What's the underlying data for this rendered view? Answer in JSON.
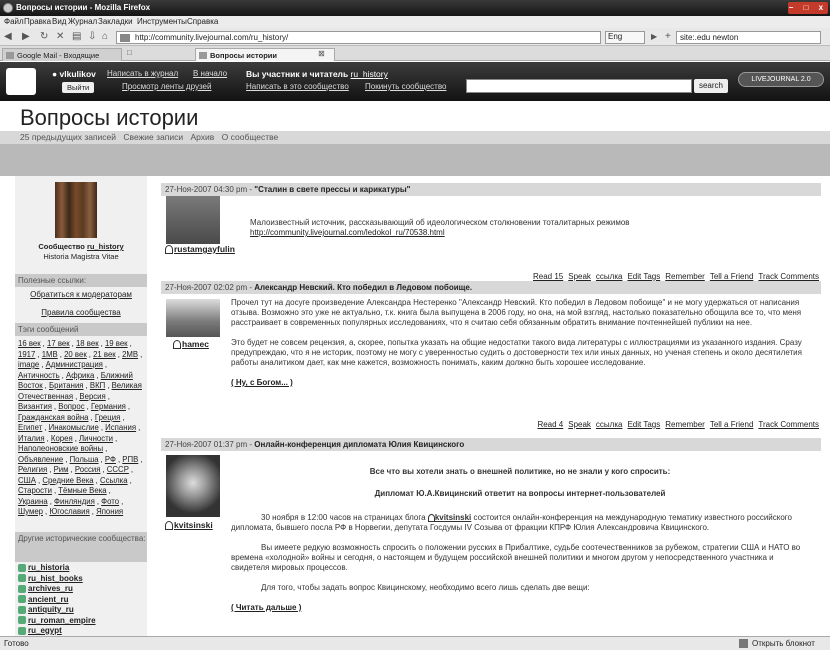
{
  "window": {
    "title": "Вопросы истории - Mozilla Firefox",
    "controls": "– □ x"
  },
  "menu": [
    "Файл",
    "Правка",
    "Вид",
    "Журнал",
    "Закладки",
    "Инструменты",
    "Справка"
  ],
  "nav": {
    "url": "http://community.livejournal.com/ru_history/",
    "search_engine": "Eng",
    "search_value": "site:.edu newton"
  },
  "tabs": [
    "Google Mail - Входящие",
    "Вопросы истории"
  ],
  "lj": {
    "username": "vlkulikov",
    "logout": "Выйти",
    "post_to_journal": "Написать в журнал",
    "to_start": "В начало",
    "friends_page": "Просмотр ленты друзей",
    "member_text": "Вы участник и читатель",
    "community": "ru_history",
    "post_to_community": "Написать в это сообщество",
    "leave_community": "Покинуть сообщество",
    "search_button": "search",
    "logo_text": "LIVEJOURNAL 2.0"
  },
  "community": {
    "title": "Вопросы истории",
    "nav": [
      "25 предыдущих записей",
      "Свежие записи",
      "Архив",
      "О сообществе"
    ]
  },
  "sidebar": {
    "community_prefix": "Сообщество",
    "community_name": "ru_history",
    "subtitle": "Historia Magistra Vitae",
    "useful_links_header": "Полезные ссылки:",
    "link_moderators": "Обратиться к модераторам",
    "link_rules": "Правила сообщества",
    "tags_header": "Тэги сообщений",
    "tags": [
      "16 век",
      "17 век",
      "18 век",
      "19 век",
      "1917",
      "1МВ",
      "20 век",
      "21 век",
      "2МВ",
      "image",
      "Администрация",
      "Античность",
      "Африка",
      "Ближний Восток",
      "Британия",
      "ВКП",
      "Великая Отечественная",
      "Версия",
      "Византия",
      "Вопрос",
      "Германия",
      "Гражданская война",
      "Греция",
      "Египет",
      "Инакомыслие",
      "Испания",
      "Италия",
      "Корея",
      "Личности",
      "Наполеоновские войны",
      "Объявление",
      "Польша",
      "РФ",
      "РПВ",
      "Религия",
      "Рим",
      "Россия",
      "СССР",
      "США",
      "Средние Века",
      "Ссылка",
      "Старости",
      "Тёмные Века",
      "Украина",
      "Финляндия",
      "Фото",
      "Шумер",
      "Югославия",
      "Япония"
    ],
    "other_header": "Другие исторические сообщества:",
    "communities": [
      "ru_historia",
      "ru_hist_books",
      "archives_ru",
      "ancient_ru",
      "antiquity_ru",
      "ru_roman_empire",
      "ru_egypt"
    ]
  },
  "posts": [
    {
      "date": "27-Ноя-2007 04:30 pm",
      "title": "\"Сталин в свете прессы и карикатуры\"",
      "user": "rustamgayfulin",
      "body": [
        "Малоизвестный источник, рассказывающий об идеологическом столкновении тоталитарных режимов"
      ],
      "link": "http://community.livejournal.com/ledokol_ru/70538.html",
      "actions": [
        "Read 15",
        "Speak",
        "ссылка",
        "Edit Tags",
        "Remember",
        "Tell a Friend",
        "Track Comments"
      ]
    },
    {
      "date": "27-Ноя-2007 02:02 pm",
      "title": "Александр Невский. Кто победил в Ледовом побоище.",
      "user": "hamec",
      "body": [
        "Прочел тут на досуге произведение Александра Нестеренко \"Александр Невский. Кто победил в Ледовом побоище\" и не могу удержаться от написания отзыва. Возможно это уже не актуально, т.к. книга была выпущена в 2006 году, но она, на мой взгляд, настолько показательно обощила все то, что меня расстраивает в современных популярных исследованиях, что я считаю себя обязанным обратить внимание почтеннейшей публики на нее.",
        "Это будет не совсем рецензия, а, скорее, попытка указать на общие недостатки такого вида литературы с иллюстрациями из указанного издания. Сразу предупреждаю, что я не историк, поэтому не могу с уверенностью судить о достоверности тех или иных данных, но ученая степень и около десятилетия работы аналитиком дает, как мне кажется, возможность понимать, каким должно быть хорошее исследование."
      ],
      "more": "( Ну, с Богом... )",
      "actions": [
        "Read 4",
        "Speak",
        "ссылка",
        "Edit Tags",
        "Remember",
        "Tell a Friend",
        "Track Comments"
      ]
    },
    {
      "date": "27-Ноя-2007 01:37 pm",
      "title": "Онлайн-конференция дипломата Юлия Квицинского",
      "user": "kvitsinski",
      "heading1": "Все что вы хотели знать о внешней политике, но не знали у кого спросить:",
      "heading2": "Дипломат Ю.А.Квицинский ответит на вопросы интернет-пользователей",
      "p1_before": "30 ноября в 12:00 часов на страницах блога",
      "p1_user": "kvitsinski",
      "p1_after": "состоится онлайн-конференция на международную тематику известного российского дипломата, бывшего посла РФ в Норвегии, депутата Госдумы IV Созыва от фракции КПРФ Юлия Александровича Квицинского.",
      "p2": "Вы имеете редкую возможность спросить о положении русских в Прибалтике, судьбе соотечественников за рубежом, стратегии США и НАТО во времена «холодной» войны и сегодня, о настоящем и будущем российской внешней политики и многом другом у непосредственного участника и свидетеля мировых процессов.",
      "p3": "Для того, чтобы задать вопрос Квицинскому, необходимо всего лишь сделать две вещи:",
      "more": "( Читать дальше )"
    }
  ],
  "status": {
    "left": "Готово",
    "right": "Открыть блокнот"
  }
}
